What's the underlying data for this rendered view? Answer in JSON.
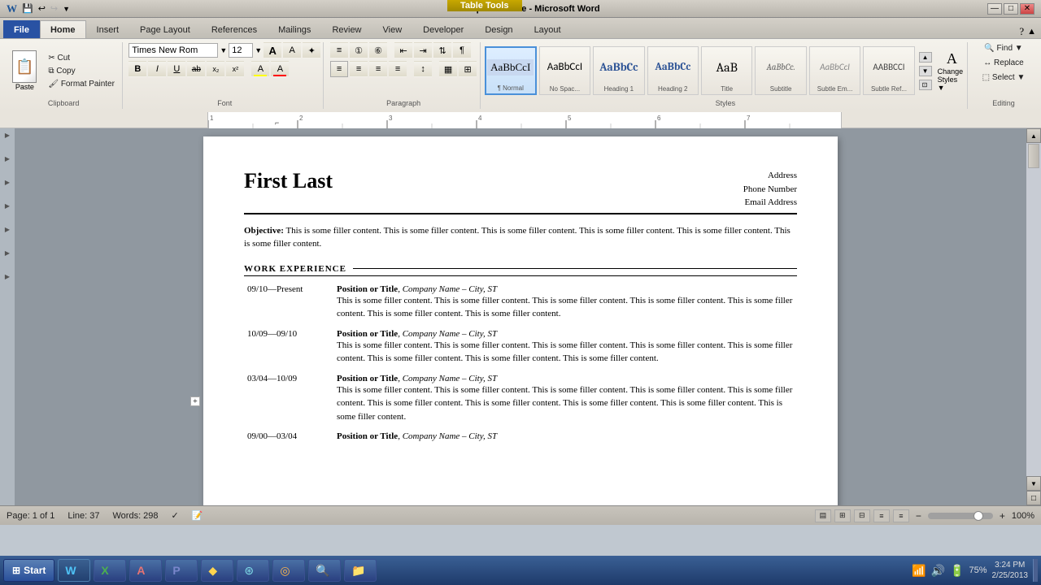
{
  "titlebar": {
    "title": "Sample Resume - Microsoft Word",
    "table_tools": "Table Tools",
    "min": "—",
    "max": "□",
    "close": "✕"
  },
  "quickaccess": {
    "save": "💾",
    "undo": "↩",
    "redo": "↪"
  },
  "ribbon": {
    "tabs": [
      "File",
      "Home",
      "Insert",
      "Page Layout",
      "References",
      "Mailings",
      "Review",
      "View",
      "Developer",
      "Design",
      "Layout"
    ],
    "active_tab": "Home",
    "font_name": "Times New Rom",
    "font_size": "12",
    "clipboard": {
      "paste": "Paste",
      "cut": "Cut",
      "copy": "Copy",
      "format_painter": "Format Painter"
    },
    "paragraph_label": "Paragraph",
    "font_label": "Font",
    "styles_label": "Styles",
    "clipboard_label": "Clipboard",
    "editing_label": "Editing",
    "styles": [
      {
        "name": "Normal",
        "preview_class": "normal-preview",
        "active": true
      },
      {
        "name": "No Spac...",
        "preview_class": "nospace-preview"
      },
      {
        "name": "Heading 1",
        "preview_class": "h1-preview"
      },
      {
        "name": "Heading 2",
        "preview_class": "h2-preview"
      },
      {
        "name": "Title",
        "preview_class": "title-preview"
      },
      {
        "name": "Subtitle",
        "preview_class": "subtitle-preview"
      },
      {
        "name": "Subtle Em...",
        "preview_class": "subtle-em-preview"
      },
      {
        "name": "Subtle Ref...",
        "preview_class": "subtle-ref-preview"
      }
    ],
    "find": "Find",
    "replace": "Replace",
    "select": "Select"
  },
  "document": {
    "name": "First Last",
    "address": "Address",
    "phone": "Phone Number",
    "email": "Email Address",
    "objective_label": "Objective:",
    "objective_text": "This is some filler content. This is some filler content. This is some filler content. This is some filler content. This is some filler content. This is some filler content.",
    "section_work": "WORK EXPERIENCE",
    "jobs": [
      {
        "date": "09/10—Present",
        "title": "Position or Title",
        "company": "Company Name – City, ST",
        "desc": "This is some filler content. This is some filler content. This is some filler content. This is some filler content. This is some filler content. This is some filler content. This is some filler content."
      },
      {
        "date": "10/09—09/10",
        "title": "Position or Title",
        "company": "Company Name – City, ST",
        "desc": "This is some filler content. This is some filler content. This is some filler content. This is some filler content. This is some filler content. This is some filler content. This is some filler content. This is some filler content."
      },
      {
        "date": "03/04—10/09",
        "title": "Position or Title",
        "company": "Company Name – City, ST",
        "desc": "This is some filler content. This is some filler content. This is some filler content. This is some filler content. This is some filler content. This is some filler content. This is some filler content. This is some filler content. This is some filler content. This is some filler content."
      },
      {
        "date": "09/00—03/04",
        "title": "Position or Title",
        "company": "Company Name – City, ST",
        "desc": ""
      }
    ]
  },
  "statusbar": {
    "page": "Page: 1 of 1",
    "line": "Line: 37",
    "words": "Words: 298",
    "zoom": "100%"
  },
  "taskbar": {
    "start": "Start",
    "time": "3:24 PM",
    "date": "2/25/2013",
    "battery": "75%",
    "apps": [
      {
        "icon": "W",
        "label": "Microsoft Word",
        "active": true
      },
      {
        "icon": "X",
        "label": ""
      },
      {
        "icon": "A",
        "label": ""
      },
      {
        "icon": "P",
        "label": ""
      },
      {
        "icon": "♦",
        "label": ""
      },
      {
        "icon": "⚙",
        "label": ""
      },
      {
        "icon": "◎",
        "label": ""
      },
      {
        "icon": "○",
        "label": ""
      },
      {
        "icon": "◉",
        "label": ""
      },
      {
        "icon": "□",
        "label": ""
      }
    ]
  }
}
